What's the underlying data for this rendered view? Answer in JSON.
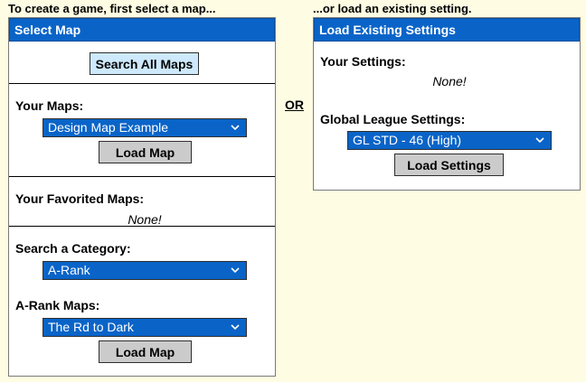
{
  "intro": {
    "left": "To create a game, first select a map...",
    "right": "...or load an existing setting."
  },
  "select_map": {
    "header": "Select Map",
    "search_all_label": "Search All Maps",
    "your_maps_label": "Your Maps:",
    "your_maps_value": "Design Map Example",
    "load_map_label": "Load Map",
    "favorited_label": "Your Favorited Maps:",
    "favorited_none": "None!",
    "category_label": "Search a Category:",
    "category_value": "A-Rank",
    "category_maps_label": "A-Rank Maps:",
    "category_maps_value": "The Rd to Dark",
    "load_map2_label": "Load Map"
  },
  "or_label": "OR",
  "load_settings": {
    "header": "Load Existing Settings",
    "your_settings_label": "Your Settings:",
    "your_settings_none": "None!",
    "global_label": "Global League Settings:",
    "global_value": "GL STD - 46 (High)",
    "load_settings_label": "Load Settings"
  },
  "icons": {
    "dropdown": "chevron-down-icon"
  },
  "colors": {
    "header_bg": "#0a64c8",
    "page_bg": "#fefce2",
    "select_bg": "#0a64c8"
  }
}
